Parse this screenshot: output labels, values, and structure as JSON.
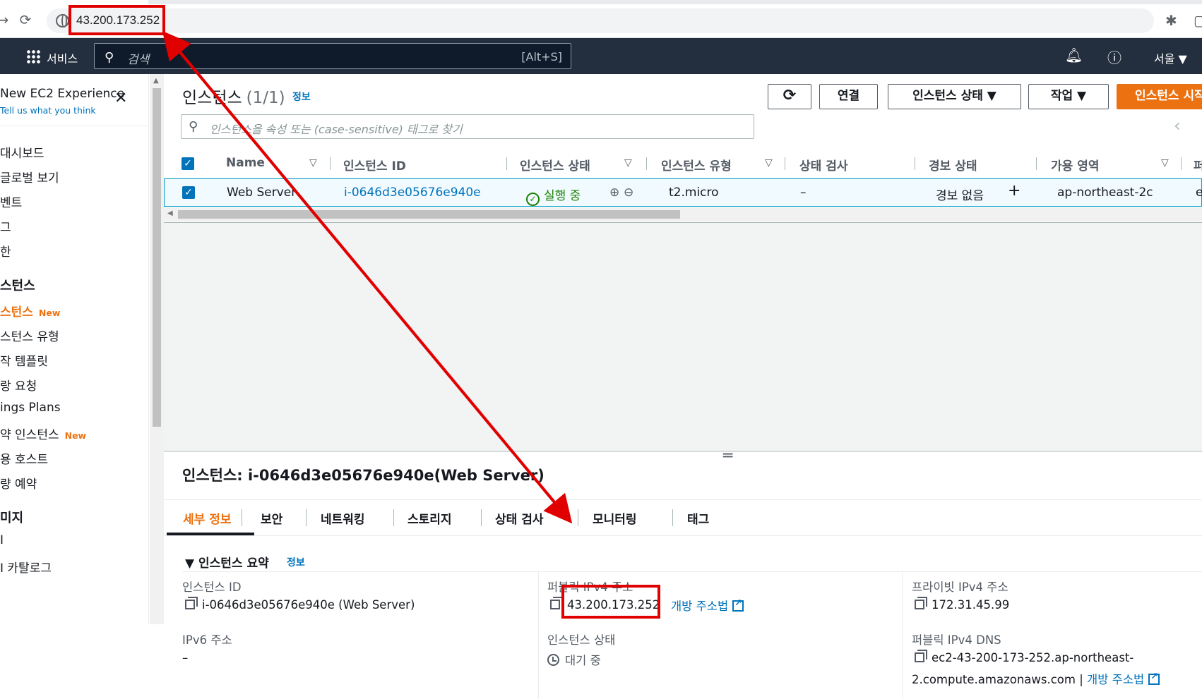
{
  "browser": {
    "url": "43.200.173.252",
    "back_icon": "arrow-right-icon",
    "reload_icon": "reload-icon"
  },
  "awsnav": {
    "services": "서비스",
    "search_placeholder": "검색",
    "search_shortcut": "[Alt+S]",
    "region": "서울 ▼"
  },
  "sidebar": {
    "new_experience": "New EC2 Experience",
    "tell_us": "Tell us what you think",
    "items": [
      {
        "label": "대시보드"
      },
      {
        "label": "글로벌 보기"
      },
      {
        "label": "벤트"
      },
      {
        "label": "그"
      },
      {
        "label": "한"
      },
      {
        "label": "스턴스"
      },
      {
        "label": "스턴스",
        "badge": "New"
      },
      {
        "label": "스턴스 유형"
      },
      {
        "label": "작 템플릿"
      },
      {
        "label": "랑 요청"
      },
      {
        "label": "ings Plans"
      },
      {
        "label": "약 인스턴스",
        "badge": "New"
      },
      {
        "label": "용 호스트"
      },
      {
        "label": "량 예약"
      },
      {
        "label": "미지"
      },
      {
        "label": "I"
      },
      {
        "label": "I 카탈로그"
      }
    ]
  },
  "main": {
    "title": "인스턴스",
    "count": "(1/1)",
    "info": "정보",
    "buttons": {
      "connect": "연결",
      "instance_state": "인스턴스 상태 ▼",
      "actions": "작업 ▼",
      "launch": "인스턴스 시작"
    },
    "filter_placeholder": "인스턴스을 속성 또는 (case-sensitive) 태그로 찾기",
    "columns": [
      "Name",
      "인스턴스 ID",
      "인스턴스 상태",
      "인스턴스 유형",
      "상태 검사",
      "경보 상태",
      "가용 영역",
      "퍼"
    ],
    "row": {
      "name": "Web Server",
      "instance_id": "i-0646d3e05676e940e",
      "state": "실행 중",
      "type": "t2.micro",
      "status_check": "–",
      "alarm": "경보 없음",
      "az": "ap-northeast-2c",
      "extra": "e"
    }
  },
  "detail": {
    "title": "인스턴스: i-0646d3e05676e940e(Web Server)",
    "tabs": [
      "세부 정보",
      "보안",
      "네트워킹",
      "스토리지",
      "상태 검사",
      "모니터링",
      "태그"
    ],
    "summary_title": "인스턴스 요약",
    "summary_info": "정보",
    "fields": {
      "instance_id_label": "인스턴스 ID",
      "instance_id_value": "i-0646d3e05676e940e (Web Server)",
      "public_ipv4_label": "퍼블릭 IPv4 주소",
      "public_ipv4_value": "43.200.173.252",
      "open_address": "개방 주소법",
      "private_ipv4_label": "프라이빗 IPv4 주소",
      "private_ipv4_value": "172.31.45.99",
      "ipv6_label": "IPv6 주소",
      "ipv6_value": "–",
      "state_label": "인스턴스 상태",
      "state_value": "대기 중",
      "public_dns_label": "퍼블릭 IPv4 DNS",
      "public_dns_value_1": "ec2-43-200-173-252.ap-northeast-",
      "public_dns_value_2": "2.compute.amazonaws.com |",
      "public_dns_open": "개방 주소법"
    }
  },
  "colors": {
    "aws_nav": "#232f3e",
    "accent_orange": "#ec7211",
    "link_blue": "#0073bb",
    "running_green": "#1d8102",
    "highlight_red": "#e10000"
  }
}
